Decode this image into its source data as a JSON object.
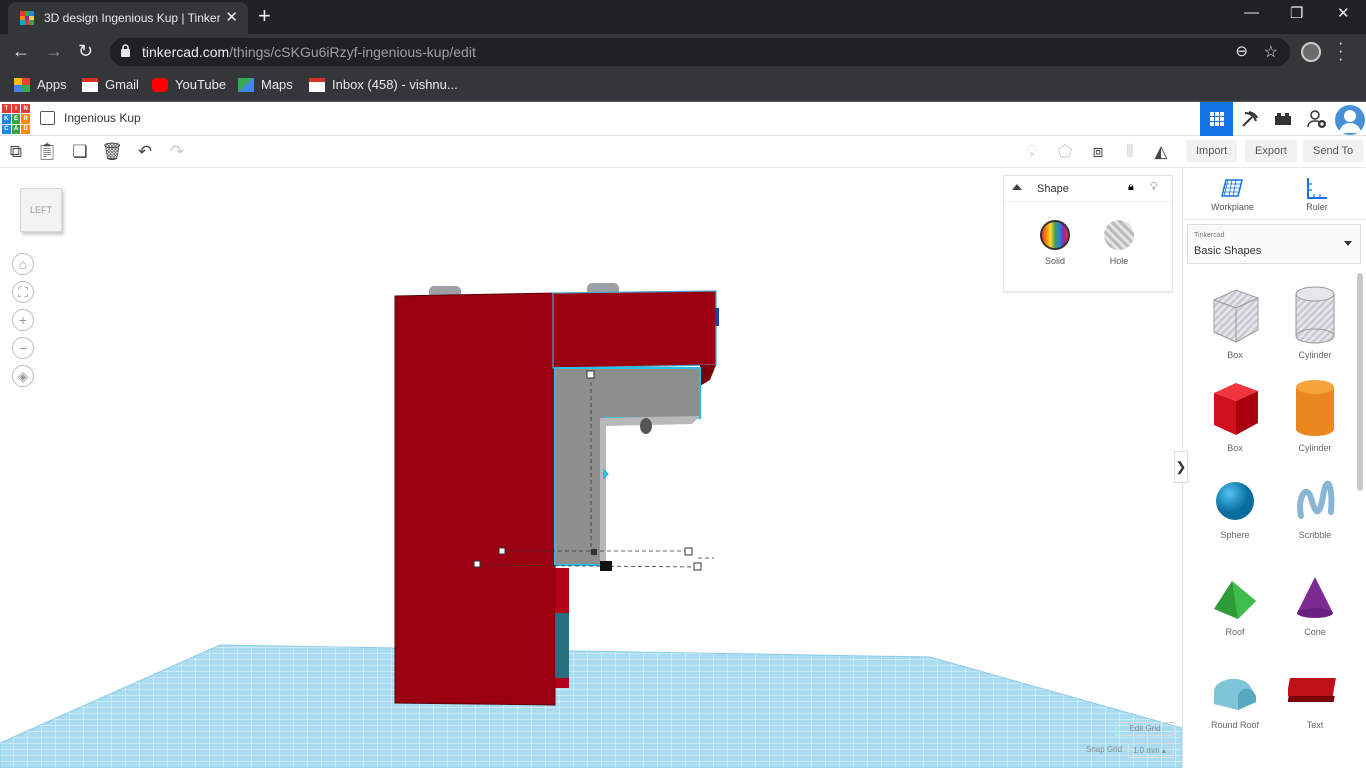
{
  "browser": {
    "tab_title": "3D design Ingenious Kup | Tinker",
    "url_host": "tinkercad.com",
    "url_path": "/things/cSKGu6iRzyf-ingenious-kup/edit",
    "bookmarks": [
      {
        "label": "Apps",
        "icon": "apps-grid-icon"
      },
      {
        "label": "Gmail",
        "icon": "gmail-icon"
      },
      {
        "label": "YouTube",
        "icon": "youtube-icon"
      },
      {
        "label": "Maps",
        "icon": "maps-icon"
      },
      {
        "label": "Inbox (458) - vishnu...",
        "icon": "gmail-icon"
      }
    ]
  },
  "app": {
    "logo_letters": [
      "T",
      "I",
      "N",
      "K",
      "E",
      "R",
      "C",
      "A",
      "D"
    ],
    "design_name": "Ingenious Kup"
  },
  "toolbar": {
    "import_label": "Import",
    "export_label": "Export",
    "send_to_label": "Send To"
  },
  "viewport": {
    "view_cube_label": "LEFT"
  },
  "shape_panel": {
    "title": "Shape",
    "solid_label": "Solid",
    "hole_label": "Hole"
  },
  "right_panel": {
    "workplane_label": "Workplane",
    "ruler_label": "Ruler",
    "library_source": "Tinkercad",
    "library_name": "Basic Shapes",
    "shapes": [
      {
        "label": "Box"
      },
      {
        "label": "Cylinder"
      },
      {
        "label": "Box"
      },
      {
        "label": "Cylinder"
      },
      {
        "label": "Sphere"
      },
      {
        "label": "Scribble"
      },
      {
        "label": "Roof"
      },
      {
        "label": "Cone"
      },
      {
        "label": "Round Roof"
      },
      {
        "label": "Text"
      }
    ]
  },
  "grid": {
    "edit_grid_label": "Edit Grid",
    "snap_grid_label": "Snap Grid",
    "snap_value": "1.0 mm"
  },
  "colors": {
    "chrome_dark": "#202124",
    "chrome_mid": "#35363a",
    "brand_blue": "#1473e6",
    "shape_red": "#9a0010",
    "workplane_blue": "#a9dcf0"
  }
}
